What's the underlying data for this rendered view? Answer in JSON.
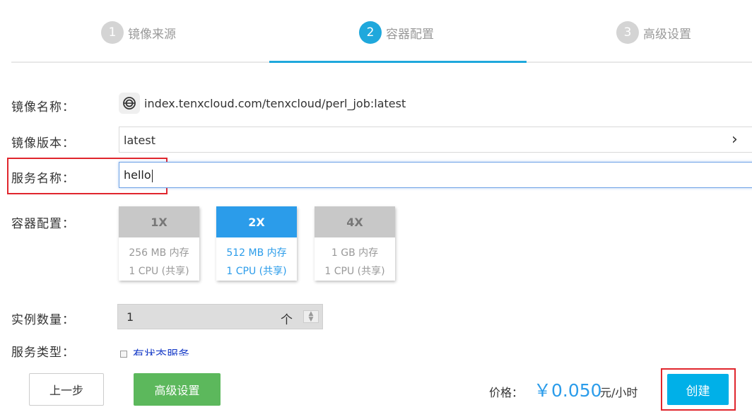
{
  "steps": [
    {
      "num": "1",
      "label": "镜像来源"
    },
    {
      "num": "2",
      "label": "容器配置"
    },
    {
      "num": "3",
      "label": "高级设置"
    }
  ],
  "form": {
    "image_name_label": "镜像名称：",
    "image_name_value": "index.tenxcloud.com/tenxcloud/perl_job:latest",
    "image_version_label": "镜像版本：",
    "image_version_value": "latest",
    "service_name_label": "服务名称：",
    "service_name_value": "hello",
    "container_config_label": "容器配置：",
    "instance_count_label": "实例数量：",
    "instance_count_value": "1",
    "instance_count_unit": "个",
    "service_type_label": "服务类型：",
    "stateful_service_label": "有状态服务"
  },
  "specs": [
    {
      "name": "1X",
      "memory": "256 MB 内存",
      "cpu": "1 CPU (共享)",
      "selected": false
    },
    {
      "name": "2X",
      "memory": "512 MB 内存",
      "cpu": "1 CPU (共享)",
      "selected": true
    },
    {
      "name": "4X",
      "memory": "1 GB 内存",
      "cpu": "1 CPU (共享)",
      "selected": false
    }
  ],
  "footer": {
    "prev_label": "上一步",
    "advanced_label": "高级设置",
    "price_label": "价格：",
    "price_value": "￥0.050",
    "price_unit": "元/小时",
    "create_label": "创建"
  },
  "colors": {
    "accent": "#1fa8dc",
    "selected_spec": "#2b9cea",
    "green_button": "#5cb85c",
    "highlight_red": "#e0262d"
  }
}
